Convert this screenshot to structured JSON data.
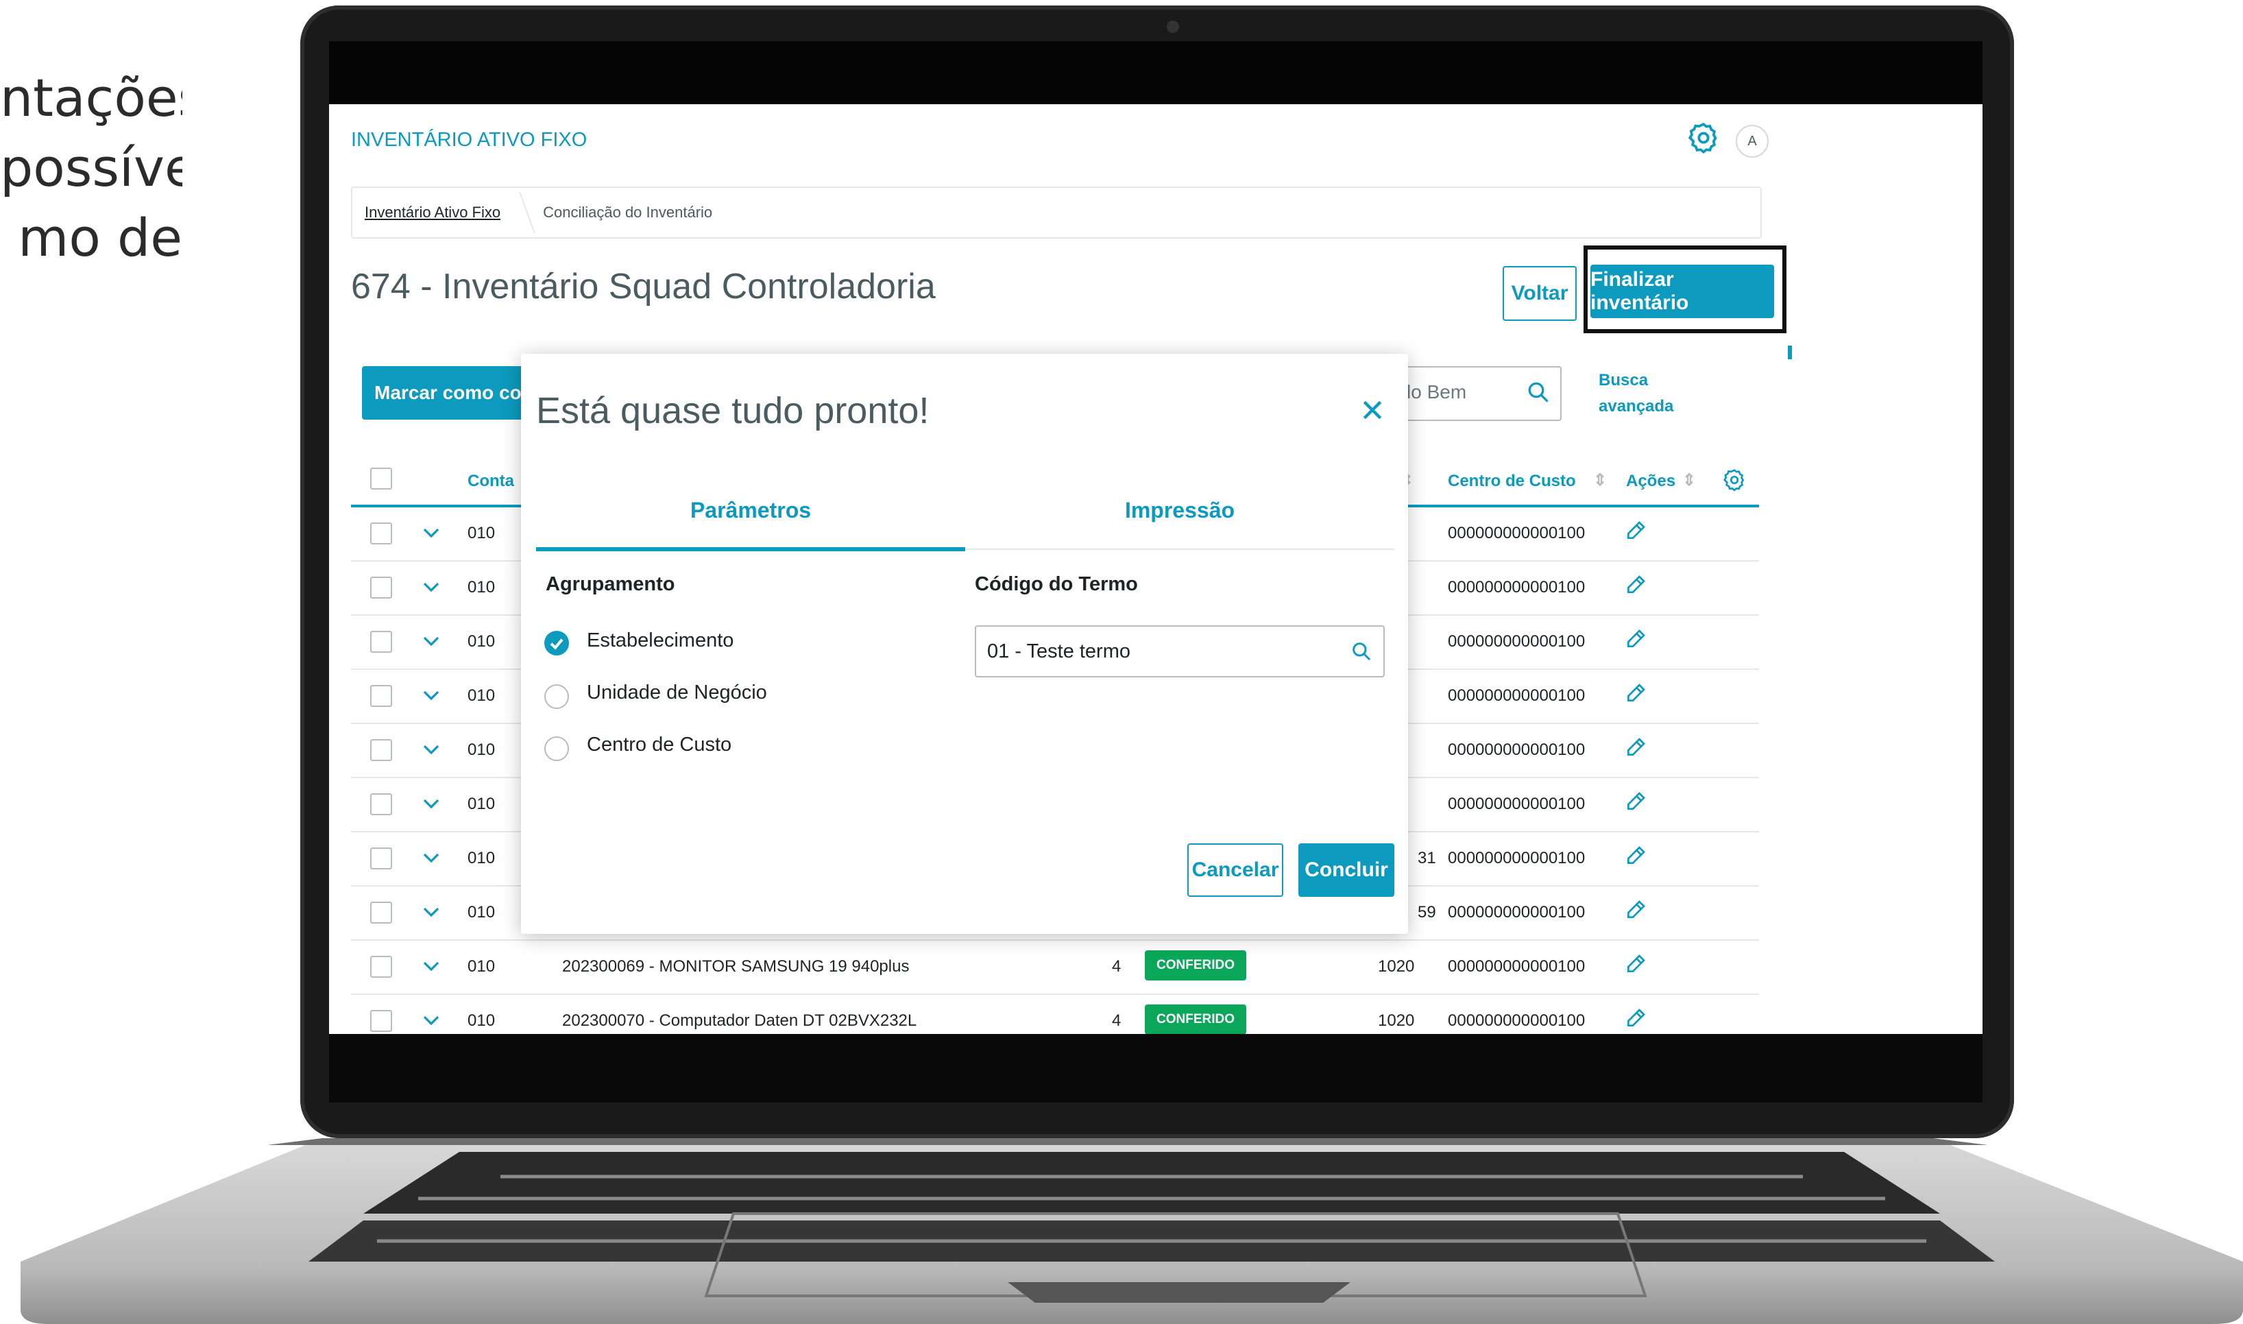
{
  "side_text": [
    "ntações",
    "possível",
    "mo   de"
  ],
  "app": {
    "title": "INVENTÁRIO ATIVO FIXO",
    "avatar_initial": "A"
  },
  "breadcrumb": {
    "link": "Inventário Ativo Fixo",
    "current": "Conciliação do Inventário"
  },
  "page": {
    "title": "674 - Inventário Squad Controladoria",
    "voltar_label": "Voltar",
    "finalizar_label": "Finalizar inventário"
  },
  "toolbar": {
    "marcar_label": "Marcar como conferido",
    "search_value": "lo Bem",
    "busca_line1": "Busca",
    "busca_line2": "avançada"
  },
  "table": {
    "headers": {
      "conta": "Conta",
      "centro": "Centro de Custo",
      "acoes": "Ações"
    },
    "rows": [
      {
        "conta": "010",
        "desc": "",
        "qtd": "",
        "status": "",
        "num": "",
        "centro": "000000000000100"
      },
      {
        "conta": "010",
        "desc": "",
        "qtd": "",
        "status": "",
        "num": "",
        "centro": "000000000000100"
      },
      {
        "conta": "010",
        "desc": "",
        "qtd": "",
        "status": "",
        "num": "",
        "centro": "000000000000100"
      },
      {
        "conta": "010",
        "desc": "",
        "qtd": "",
        "status": "",
        "num": "",
        "centro": "000000000000100"
      },
      {
        "conta": "010",
        "desc": "",
        "qtd": "",
        "status": "",
        "num": "",
        "centro": "000000000000100"
      },
      {
        "conta": "010",
        "desc": "",
        "qtd": "",
        "status": "",
        "num": "",
        "centro": "000000000000100"
      },
      {
        "conta": "010",
        "desc": "",
        "qtd": "",
        "status": "",
        "num": "31",
        "centro": "000000000000100"
      },
      {
        "conta": "010",
        "desc": "",
        "qtd": "",
        "status": "",
        "num": "59",
        "centro": "000000000000100"
      },
      {
        "conta": "010",
        "desc": "202300069 - MONITOR SAMSUNG 19 940plus",
        "qtd": "4",
        "status": "CONFERIDO",
        "num": "1020",
        "centro": "000000000000100"
      },
      {
        "conta": "010",
        "desc": "202300070 - Computador Daten DT 02BVX232L",
        "qtd": "4",
        "status": "CONFERIDO",
        "num": "1020",
        "centro": "000000000000100"
      }
    ]
  },
  "modal": {
    "title": "Está quase tudo pronto!",
    "tabs": [
      "Parâmetros",
      "Impressão"
    ],
    "agrupamento_label": "Agrupamento",
    "options": [
      {
        "label": "Estabelecimento",
        "selected": true
      },
      {
        "label": "Unidade de Negócio",
        "selected": false
      },
      {
        "label": "Centro de Custo",
        "selected": false
      }
    ],
    "codigo_label": "Código do Termo",
    "codigo_value": "01 - Teste termo",
    "cancel_label": "Cancelar",
    "ok_label": "Concluir"
  },
  "colors": {
    "accent": "#0c9abe",
    "success": "#0aa65a",
    "text": "#4a5c60"
  }
}
